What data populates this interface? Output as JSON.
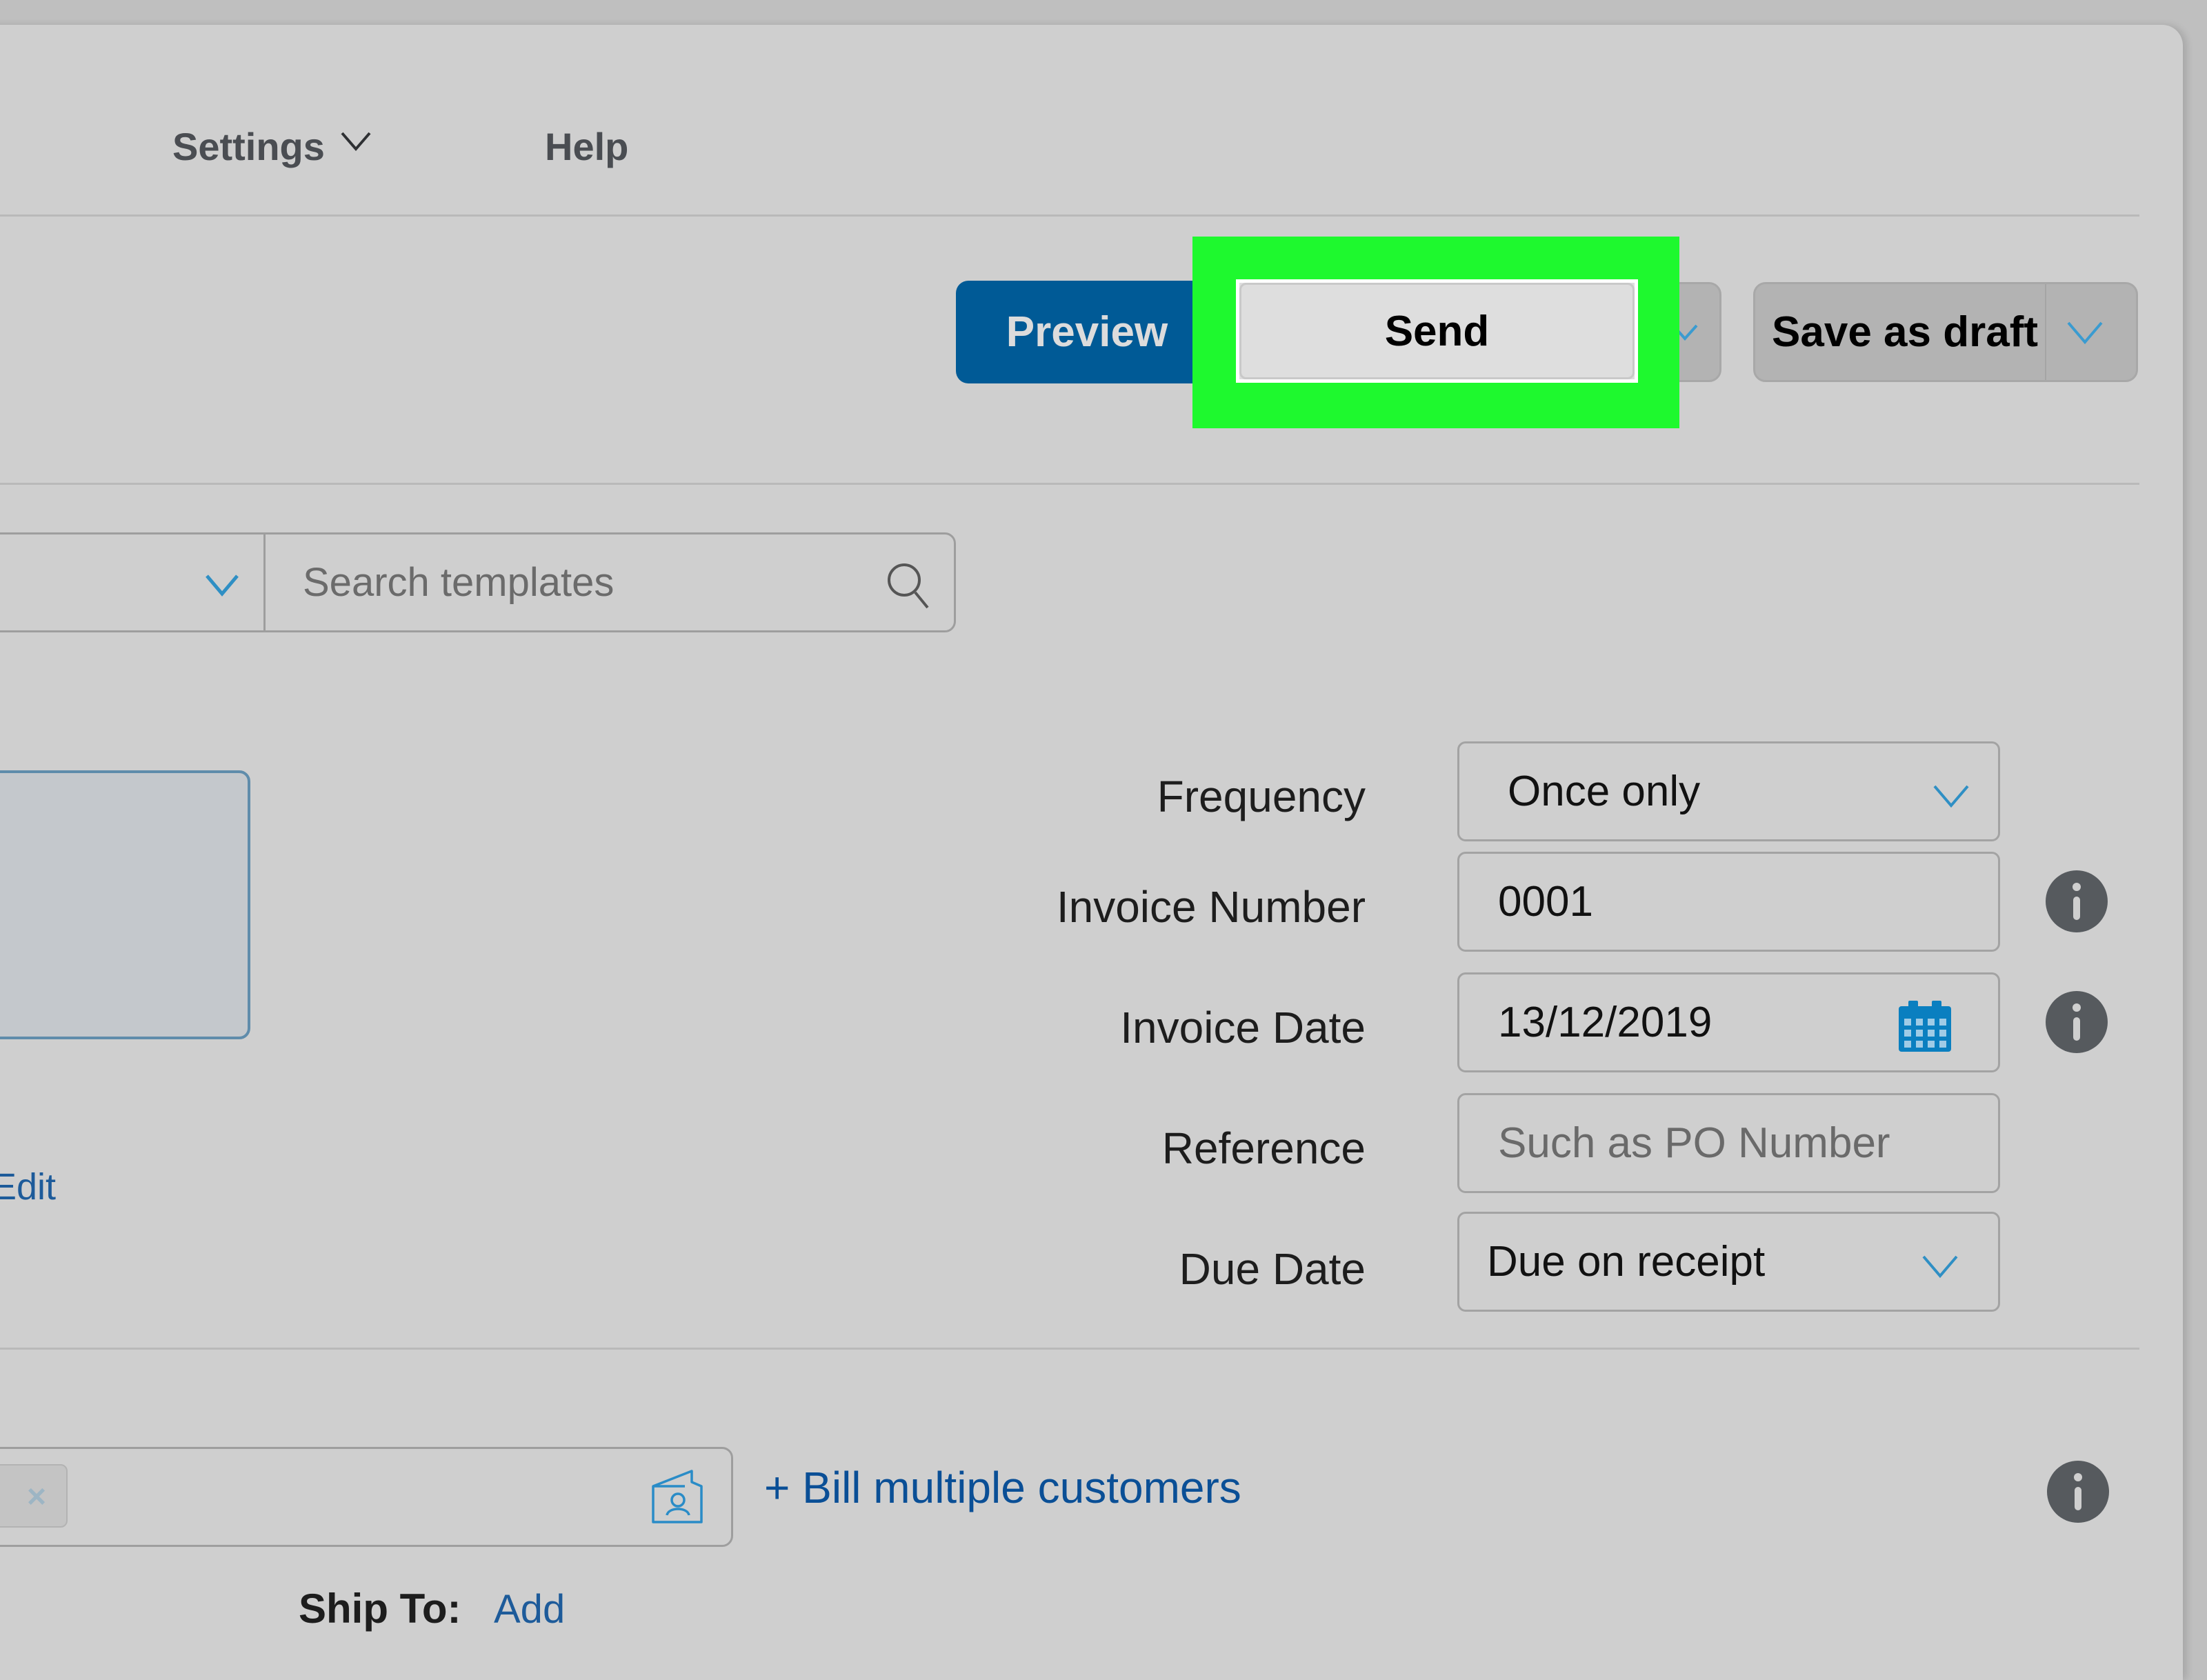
{
  "nav": {
    "items": [
      {
        "label": "Settings",
        "icon": "chevron-down-icon"
      },
      {
        "label": "Help"
      }
    ]
  },
  "toolbar": {
    "preview_label": "Preview",
    "send_label": "Send",
    "save_draft_label": "Save as draft",
    "accent_color": "#005a96",
    "highlight_color": "#1ef92e"
  },
  "templates": {
    "dropdown_value": "",
    "search_placeholder": "Search templates"
  },
  "logo": {
    "edit_label": "Edit"
  },
  "form": {
    "frequency": {
      "label": "Frequency",
      "value": "Once only"
    },
    "invoice_number": {
      "label": "Invoice Number",
      "value": "0001"
    },
    "invoice_date": {
      "label": "Invoice Date",
      "value": "13/12/2019"
    },
    "reference": {
      "label": "Reference",
      "value": "",
      "placeholder": "Such as PO Number"
    },
    "due_date": {
      "label": "Due Date",
      "value": "Due on receipt"
    }
  },
  "customer": {
    "chip_remove": "×",
    "bill_multiple_label": "+ Bill multiple customers",
    "ship_to_label": "Ship To:",
    "ship_to_add": "Add"
  }
}
